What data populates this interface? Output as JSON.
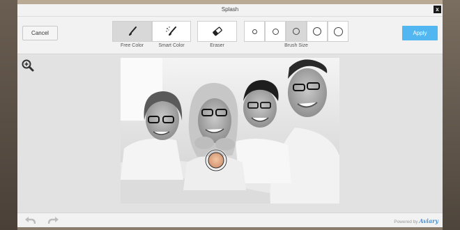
{
  "dialog": {
    "title": "Splash",
    "close_label": "x"
  },
  "toolbar": {
    "cancel_label": "Cancel",
    "apply_label": "Apply",
    "tools": [
      {
        "label": "Free Color",
        "icon": "brush-icon",
        "selected": true
      },
      {
        "label": "Smart Color",
        "icon": "magic-brush-icon",
        "selected": false
      },
      {
        "label": "Eraser",
        "icon": "eraser-icon",
        "selected": false
      }
    ],
    "brush_size_label": "Brush Size",
    "brush_sizes": [
      {
        "name": "brush-size-1",
        "selected": false
      },
      {
        "name": "brush-size-2",
        "selected": false
      },
      {
        "name": "brush-size-3",
        "selected": true
      },
      {
        "name": "brush-size-4",
        "selected": false
      },
      {
        "name": "brush-size-5",
        "selected": false
      }
    ]
  },
  "footer": {
    "powered_by": "Powered by",
    "brand": "Aviary"
  },
  "colors": {
    "accent": "#52b7f0",
    "panel": "#f2f2f2",
    "canvas_bg": "#e2e2e2"
  }
}
